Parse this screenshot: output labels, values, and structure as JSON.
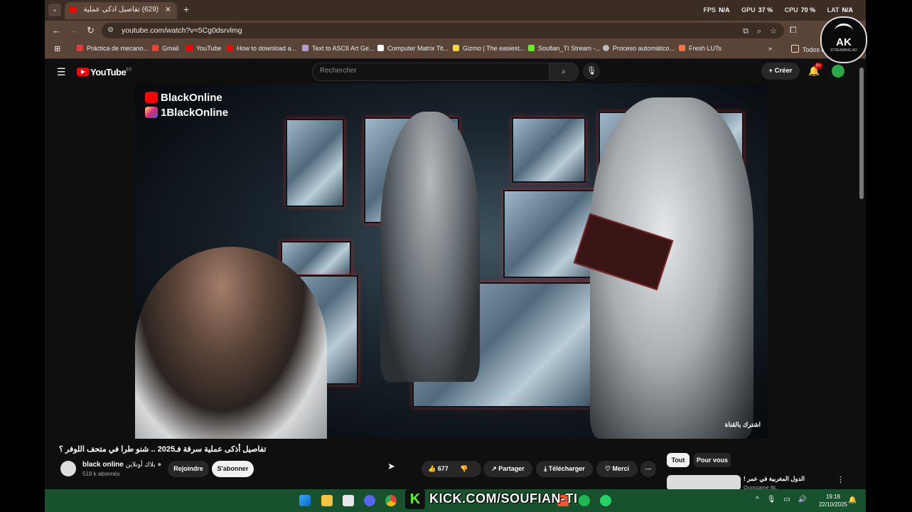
{
  "browser": {
    "tab_title": "(629) تفاصيل أذكى عملية سـ",
    "url": "youtube.com/watch?v=5Cg0dsrvlmg",
    "new_tab": "+",
    "tab_close": "✕"
  },
  "overlay_stats": {
    "fps_label": "FPS",
    "fps_value": "N/A",
    "gpu_label": "GPU",
    "gpu_value": "37 %",
    "cpu_label": "CPU",
    "cpu_value": "70 %",
    "lat_label": "LAT",
    "lat_value": "N/A"
  },
  "bookmarks": [
    {
      "label": "Práctica de mecano...",
      "color": "#e53935"
    },
    {
      "label": "Gmail",
      "color": "#ea4335"
    },
    {
      "label": "YouTube",
      "color": "#ff0000"
    },
    {
      "label": "How to download a...",
      "color": "#ff0000"
    },
    {
      "label": "Text to ASCII Art Ge...",
      "color": "#b39ddb"
    },
    {
      "label": "Computer Matrix Tit...",
      "color": "#ffffff"
    },
    {
      "label": "Gizmo | The easiest...",
      "color": "#fdd835"
    },
    {
      "label": "Soufian_TI Stream -...",
      "color": "#53fc18"
    },
    {
      "label": "Proceso automático...",
      "color": "#bbbbbb"
    },
    {
      "label": "Fresh LUTs",
      "color": "#ff7043"
    }
  ],
  "bookmarks_more": "»",
  "bookmarks_folder": "Todos lo",
  "youtube": {
    "logo_text": "YouTube",
    "logo_region": "ES",
    "search_placeholder": "Rechercher",
    "create_label": "Créer",
    "notif_badge": "9+"
  },
  "video": {
    "watermark_channel": "BlackOnline",
    "watermark_instagram": "1BlackOnline",
    "corner_mark": "اشترك بالقناة",
    "title": "تفاصيل أذكى عملية سرقة فـ2025 .. شنو طرا في متحف اللوفر ؟",
    "channel_name": "black online",
    "channel_alt": "بلاك أونلاين",
    "subscribers": "519 k abonnés",
    "join_label": "Rejoindre",
    "subscribe_label": "S'abonner",
    "likes": "677",
    "share_label": "Partager",
    "download_label": "Télécharger",
    "thanks_label": "Merci"
  },
  "sidebar": {
    "chips": [
      "Tout",
      "Pour vous"
    ],
    "rec_title": "الدول المغربية في عمر !",
    "rec_channel": "Ouyssame BL"
  },
  "taskbar": {
    "kick_text": "KICK.COM/SOUFIAN-TI",
    "time": "19:18",
    "date": "22/10/2025"
  },
  "stream_logo": {
    "text": "AK",
    "sub": "STREAMING AD"
  }
}
